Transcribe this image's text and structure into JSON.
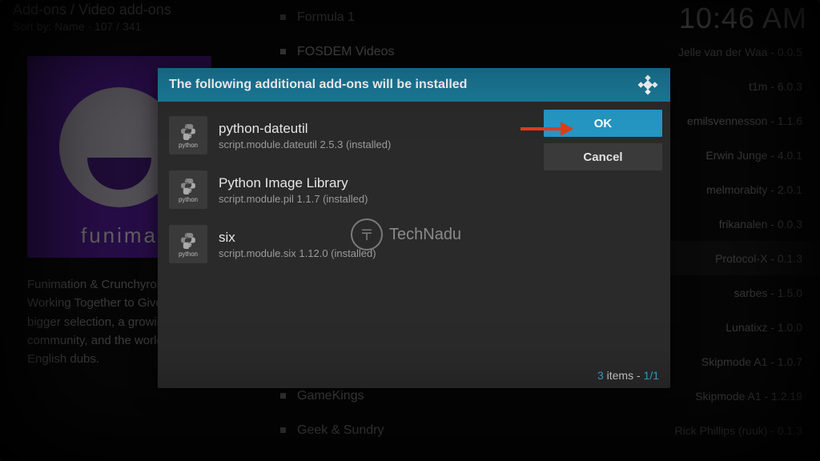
{
  "header": {
    "breadcrumb": "Add-ons / Video add-ons",
    "sort_label": "Sort by: Name",
    "position": "107 / 341",
    "clock": "10:46 AM"
  },
  "featured": {
    "logo_text": "funima",
    "description": "Funimation & Crunchyroll Working Together to Give A bigger selection, a growing community, and the world's English dubs."
  },
  "addons": [
    {
      "name": "Formula 1",
      "meta": ""
    },
    {
      "name": "FOSDEM Videos",
      "meta": "Jelle van der Waa - 0.0.5"
    },
    {
      "name": "",
      "meta": "t1m - 6.0.3"
    },
    {
      "name": "",
      "meta": "emilsvennesson - 1.1.6"
    },
    {
      "name": "",
      "meta": "Erwin Junge - 4.0.1"
    },
    {
      "name": "",
      "meta": "melmorabity - 2.0.1"
    },
    {
      "name": "",
      "meta": "frikanalen - 0.0.3"
    },
    {
      "name": "",
      "meta": "Protocol-X - 0.1.3",
      "highlight": true
    },
    {
      "name": "",
      "meta": "sarbes - 1.5.0"
    },
    {
      "name": "",
      "meta": "Lunatixz - 1.0.0"
    },
    {
      "name": "",
      "meta": "Skipmode A1 - 1.0.7"
    },
    {
      "name": "GameKings",
      "meta": "Skipmode A1 - 1.2.19"
    },
    {
      "name": "Geek & Sundry",
      "meta": "Rick Phillips (ruuk) - 0.1.3"
    }
  ],
  "dialog": {
    "title": "The following additional add-ons will be installed",
    "ok_label": "OK",
    "cancel_label": "Cancel",
    "footer_count": "3",
    "footer_items": " items - ",
    "footer_page": "1/1",
    "deps": [
      {
        "name": "python-dateutil",
        "sub": "script.module.dateutil 2.5.3 (installed)",
        "icon_label": "python"
      },
      {
        "name": "Python Image Library",
        "sub": "script.module.pil 1.1.7 (installed)",
        "icon_label": "python"
      },
      {
        "name": "six",
        "sub": "script.module.six 1.12.0 (installed)",
        "icon_label": "python"
      }
    ]
  },
  "watermark": {
    "text": "TechNadu"
  }
}
